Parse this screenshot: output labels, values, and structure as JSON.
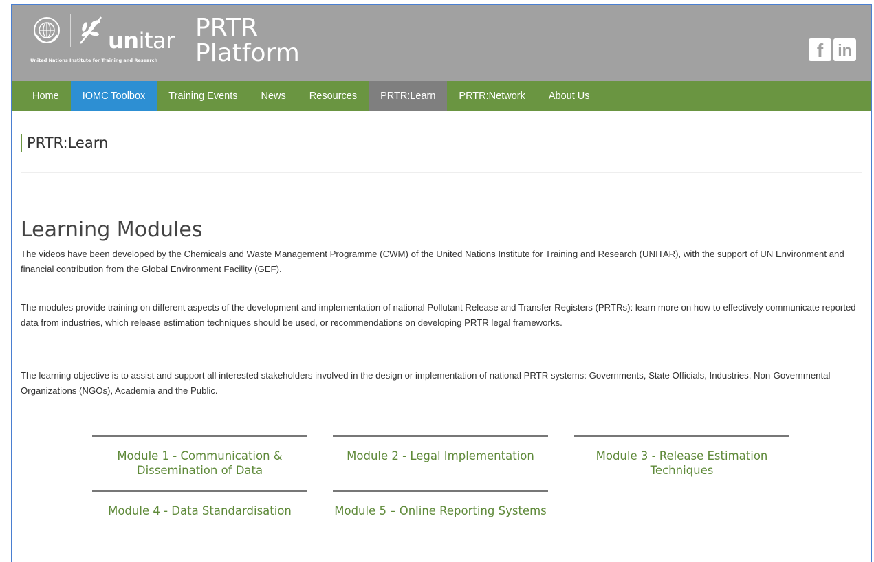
{
  "header": {
    "brand_line1": "PRTR",
    "brand_line2": "Platform",
    "logo_word_bold": "un",
    "logo_word_rest": "itar",
    "logo_tagline": "United Nations Institute for Training and Research",
    "social": {
      "facebook": "f",
      "linkedin": "in"
    }
  },
  "nav": {
    "items": [
      {
        "label": "Home"
      },
      {
        "label": "IOMC Toolbox"
      },
      {
        "label": "Training Events"
      },
      {
        "label": "News"
      },
      {
        "label": "Resources"
      },
      {
        "label": "PRTR:Learn"
      },
      {
        "label": "PRTR:Network"
      },
      {
        "label": "About Us"
      }
    ]
  },
  "page": {
    "title": "PRTR:Learn",
    "section_heading": "Learning Modules",
    "paragraphs": [
      "The videos have been developed by the Chemicals and Waste Management Programme (CWM) of the United Nations Institute for Training and Research (UNITAR), with the support of UN Environment and financial contribution from the Global Environment Facility (GEF).",
      "The modules provide training on different aspects of the development and implementation of national Pollutant Release and Transfer Registers (PRTRs): learn more on how to effectively communicate reported data from industries, which release estimation techniques should be used, or recommendations on developing PRTR legal frameworks.",
      "The learning objective is to assist and support all interested stakeholders involved in the design or implementation of national PRTR systems: Governments, State Officials, Industries, Non-Governmental Organizations (NGOs), Academia and the Public."
    ]
  },
  "modules": [
    {
      "label": "Module 1 - Communication & Dissemination of Data"
    },
    {
      "label": "Module 2 - Legal Implementation"
    },
    {
      "label": "Module 3 - Release Estimation Techniques"
    },
    {
      "label": "Module 4 - Data Standardisation"
    },
    {
      "label": "Module 5 – Online Reporting Systems"
    }
  ],
  "colors": {
    "header_bg": "#a1a1a1",
    "nav_bg": "#6a9541",
    "nav_highlight": "#2d8fd3",
    "nav_active": "#7f7f7f",
    "module_text": "#5f8a3a"
  }
}
